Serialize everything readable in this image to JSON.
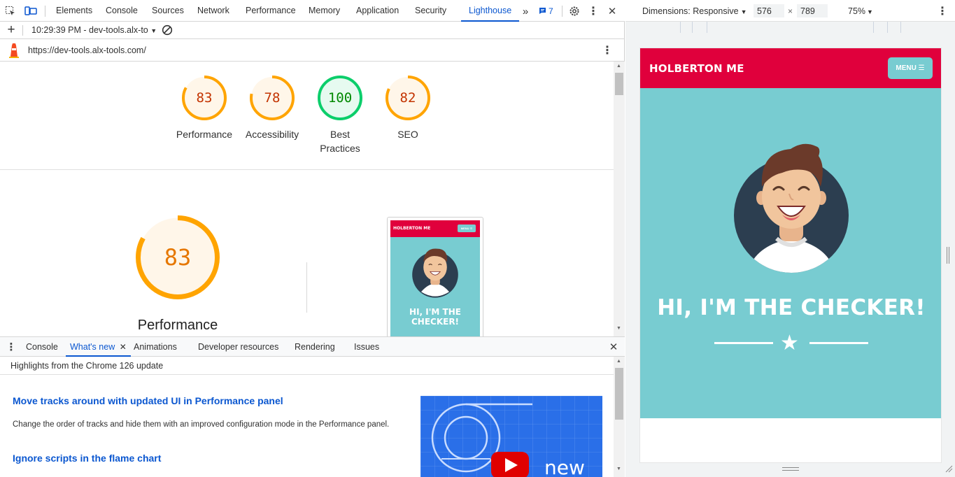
{
  "devtools": {
    "tabs": [
      "Elements",
      "Console",
      "Sources",
      "Network",
      "Performance",
      "Memory",
      "Application",
      "Security",
      "Lighthouse"
    ],
    "active_tab": "Lighthouse",
    "issues_count": "7",
    "toolbar": {
      "timestamp_select": "10:29:39 PM - dev-tools.alx-to",
      "url": "https://dev-tools.alx-tools.com/"
    },
    "lighthouse": {
      "scores": [
        {
          "label": "Performance",
          "value": "83",
          "status": "average"
        },
        {
          "label": "Accessibility",
          "value": "78",
          "status": "average"
        },
        {
          "label": "Best Practices",
          "value": "100",
          "status": "pass"
        },
        {
          "label": "SEO",
          "value": "82",
          "status": "average"
        }
      ],
      "big_score": {
        "label": "Performance",
        "value": "83"
      },
      "thumbnail": {
        "brand": "HOLBERTON ME",
        "menu": "MENU ☰",
        "heading": "HI, I'M THE CHECKER!"
      }
    },
    "drawer": {
      "tabs": [
        "Console",
        "What's new",
        "Animations",
        "Developer resources",
        "Rendering",
        "Issues"
      ],
      "active_tab": "What's new",
      "highlight": "Highlights from the Chrome 126 update",
      "items": [
        {
          "title": "Move tracks around with updated UI in Performance panel",
          "body": "Change the order of tracks and hide them with an improved configuration mode in the Performance panel."
        },
        {
          "title": "Ignore scripts in the flame chart",
          "body": ""
        }
      ],
      "video_label": "new"
    }
  },
  "device_toolbar": {
    "dimensions_label": "Dimensions: Responsive",
    "width": "576",
    "height": "789",
    "times": "×",
    "zoom": "75%"
  },
  "site": {
    "brand": "HOLBERTON ME",
    "menu_label": "MENU ☰",
    "heading": "HI, I'M THE CHECKER!"
  },
  "colors": {
    "accent": "#0b57d0",
    "average": "#ffa400",
    "pass": "#0cce6b",
    "site_red": "#e0003c",
    "site_teal": "#78ccd1"
  }
}
